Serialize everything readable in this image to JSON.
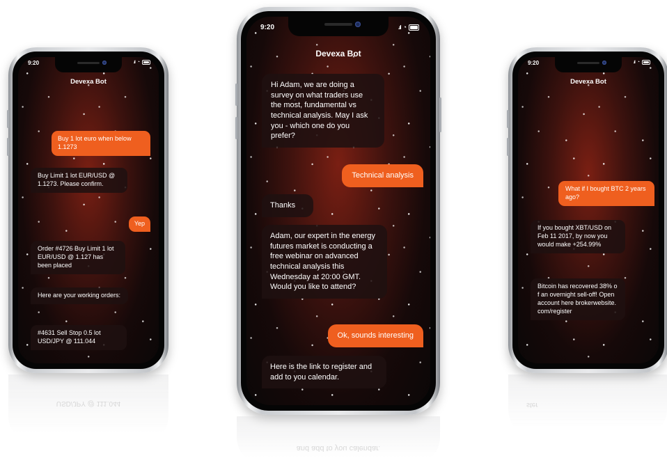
{
  "phones": [
    {
      "status_time": "9:20",
      "title": "Devexa Bot",
      "messages": [
        {
          "from": "user",
          "text": "Buy 1 lot euro when below 1.1273"
        },
        {
          "from": "bot",
          "text": "Buy Limit 1 lot EUR/USD @ 1.1273. Please confirm."
        },
        {
          "from": "user",
          "text": "Yep"
        },
        {
          "from": "bot",
          "text": "Order #4726 Buy Limit 1 lot EUR/USD @ 1.127 has been placed"
        },
        {
          "from": "bot",
          "text": "Here are your working orders:"
        },
        {
          "from": "bot",
          "text": "#4631 Sell Stop 0.5 lot USD/JPY @ 111.044"
        }
      ]
    },
    {
      "status_time": "9:20",
      "title": "Devexa Bot",
      "messages": [
        {
          "from": "bot",
          "text": "Hi Adam, we are doing a survey on what traders use the most, fundamental vs technical analysis. May I ask you - which one do you prefer?"
        },
        {
          "from": "user",
          "text": "Technical analysis"
        },
        {
          "from": "bot",
          "text": "Thanks"
        },
        {
          "from": "bot",
          "text": "Adam, our expert in the energy futures market is conducting a free webinar on advanced technical analysis this Wednesday at 20:00 GMT. Would you like to attend?"
        },
        {
          "from": "user",
          "text": "Ok, sounds interesting"
        },
        {
          "from": "bot",
          "text": "Here is the link to register and add to you calendar."
        }
      ]
    },
    {
      "status_time": "9:20",
      "title": "Devexa Bot",
      "messages": [
        {
          "from": "user",
          "text": "What if I bought BTC 2 years ago?"
        },
        {
          "from": "bot",
          "text": "If you bought XBT/USD on Feb 11 2017, by now you would make +254.99%"
        },
        {
          "from": "bot",
          "text": "Bitcoin has recovered 38% of an overnight sell-off! Open account here brokerwebsite.com/register"
        }
      ]
    }
  ],
  "reflections": [
    {
      "text": "USD/JPY @ 111.044"
    },
    {
      "text": "and add to you calendar."
    },
    {
      "text": "ster"
    }
  ],
  "colors": {
    "user_bubble": "#ef5f1f",
    "bot_bubble": "#1e1010",
    "screen_glow": "#7a1f13"
  },
  "icons": [
    "signal-icon",
    "wifi-icon",
    "battery-icon"
  ]
}
